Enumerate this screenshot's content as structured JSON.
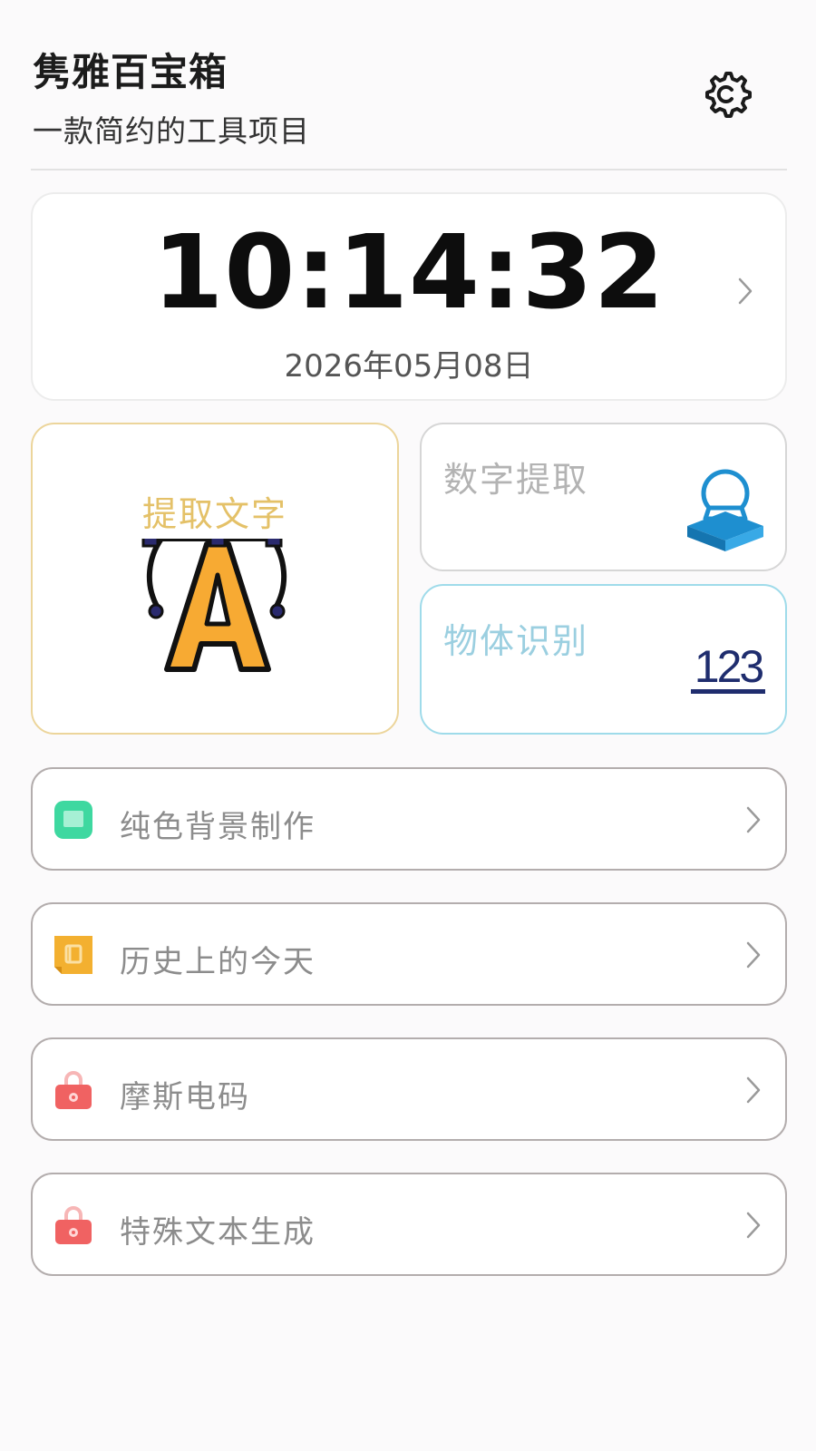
{
  "header": {
    "title": "隽雅百宝箱",
    "subtitle": "一款简约的工具项目"
  },
  "icons": {
    "settings": "gear-icon",
    "chevron": "chevron-right-icon",
    "extract_text": "vector-pen-letter-a-icon",
    "digit_extract": "stamp-icon",
    "object_recognition": "numbers-123-icon",
    "solid_background": "green-picture-icon",
    "history_today": "yellow-calendar-icon",
    "morse_code": "red-lock-icon",
    "special_text": "red-lock-icon"
  },
  "clock": {
    "time": "10:14:32",
    "date": "2026年05月08日"
  },
  "tiles": {
    "extract_text": {
      "label": "提取文字",
      "color": "#e4c168"
    },
    "digit_extract": {
      "label": "数字提取",
      "color": "#b3b3b3"
    },
    "object_recognition": {
      "label": "物体识别",
      "color": "#9bcfe0",
      "icon_text": "123"
    }
  },
  "list": [
    {
      "label": "纯色背景制作",
      "accent": "#3ed8a0"
    },
    {
      "label": "历史上的今天",
      "accent": "#f3b030"
    },
    {
      "label": "摩斯电码",
      "accent": "#f06262"
    },
    {
      "label": "特殊文本生成",
      "accent": "#f06262"
    }
  ]
}
